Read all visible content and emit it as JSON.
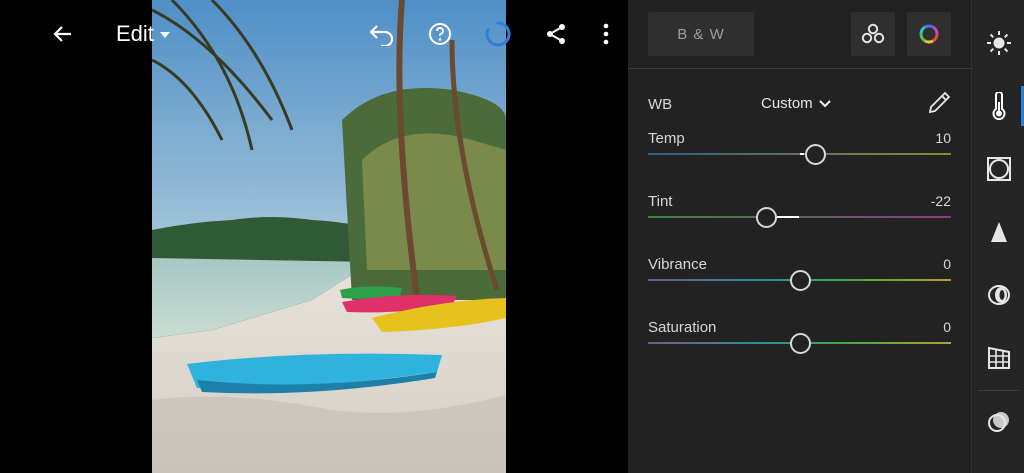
{
  "topbar": {
    "back_icon": "arrow-left-icon",
    "edit_label": "Edit",
    "undo_icon": "undo-icon",
    "help_icon": "help-icon",
    "sync_icon": "sync-spinner-icon",
    "share_icon": "share-icon",
    "more_icon": "more-vertical-icon"
  },
  "panel": {
    "bw_label": "B & W",
    "presets_icon": "presets-icon",
    "profile_icon": "color-profile-icon",
    "wb": {
      "label": "WB",
      "value": "Custom",
      "eyedropper_icon": "eyedropper-icon"
    },
    "sliders": [
      {
        "id": "temp",
        "label": "Temp",
        "value": "10",
        "position": 0.55,
        "gradient": [
          "#2f5f86",
          "#8a8a2f"
        ]
      },
      {
        "id": "tint",
        "label": "Tint",
        "value": "-22",
        "position": 0.39,
        "gradient": [
          "#3b8a3b",
          "#8a3b8a"
        ]
      },
      {
        "id": "vibrance",
        "label": "Vibrance",
        "value": "0",
        "position": 0.5,
        "gradient": [
          "#7a5a8a",
          "#2f8aa0",
          "#46a846",
          "#b0a030"
        ]
      },
      {
        "id": "saturation",
        "label": "Saturation",
        "value": "0",
        "position": 0.5,
        "gradient": [
          "#7a5a8a",
          "#2f8aa0",
          "#46a846",
          "#b0a030"
        ]
      }
    ]
  },
  "rail": {
    "items": [
      {
        "name": "light",
        "icon": "sun-icon"
      },
      {
        "name": "color",
        "icon": "thermometer-icon",
        "active": true
      },
      {
        "name": "effects",
        "icon": "vignette-icon"
      },
      {
        "name": "detail",
        "icon": "triangle-icon"
      },
      {
        "name": "optics",
        "icon": "lens-icon"
      },
      {
        "name": "geometry",
        "icon": "grid-perspective-icon"
      },
      {
        "name": "masking",
        "icon": "mask-circles-icon"
      }
    ],
    "accent": "#2f7fd6"
  },
  "colors": {
    "panel_bg": "#222222",
    "accent": "#2f7fd6"
  }
}
